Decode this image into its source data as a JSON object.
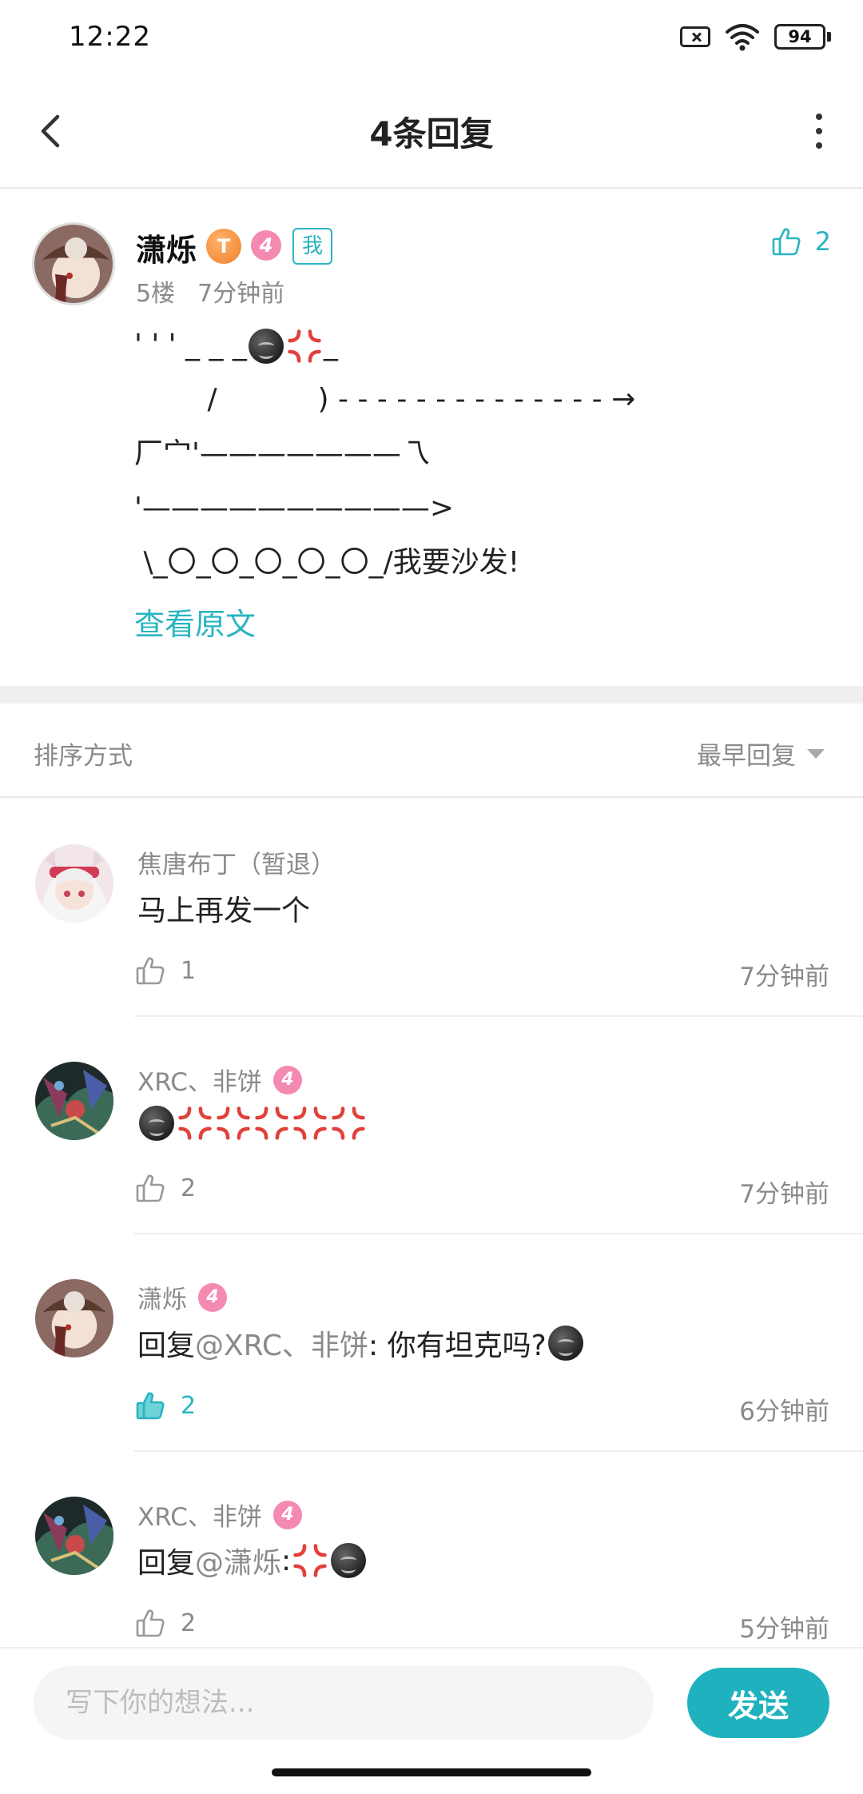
{
  "status_bar": {
    "time": "12:22",
    "battery": "94"
  },
  "header": {
    "title": "4条回复"
  },
  "post": {
    "author": "潇烁",
    "badge_tg": "T",
    "level": "4",
    "me_tag": "我",
    "likes": "2",
    "floor": "5楼",
    "time": "7分钟前",
    "lines": {
      "l1": "' ' ' _ _ _",
      "l1_tail": "_",
      "l2": "        /           ) - - - - - - - - - - - - - - →",
      "l3": "厂宀'———————乁",
      "l4": "'——————————>",
      "l5": " \\_〇_〇_〇_〇_〇_/我要沙发!"
    },
    "view_original": "查看原文"
  },
  "sort": {
    "label": "排序方式",
    "value": "最早回复"
  },
  "replies": [
    {
      "author": "焦唐布丁（暂退）",
      "text": "马上再发一个",
      "likes": "1",
      "time": "7分钟前"
    },
    {
      "author": "XRC、非饼",
      "level": "4",
      "likes": "2",
      "time": "7分钟前"
    },
    {
      "author": "潇烁",
      "level": "4",
      "prefix": "回复",
      "mention": "@XRC、非饼",
      "text": ": 你有坦克吗?",
      "likes": "2",
      "time": "6分钟前"
    },
    {
      "author": "XRC、非饼",
      "level": "4",
      "prefix": "回复",
      "mention": "@潇烁",
      "text": ": ",
      "likes": "2",
      "time": "5分钟前"
    }
  ],
  "input": {
    "placeholder": "写下你的想法...",
    "send_label": "发送"
  },
  "colors": {
    "accent": "#1fb2be",
    "level_badge": "#f489b1",
    "muted_text": "#8a8a8a"
  },
  "icons": [
    "back-arrow-icon",
    "more-vertical-icon",
    "thumbs-up-icon",
    "dark-face-emoji-icon",
    "anger-emoji-icon",
    "chevron-down-icon"
  ]
}
